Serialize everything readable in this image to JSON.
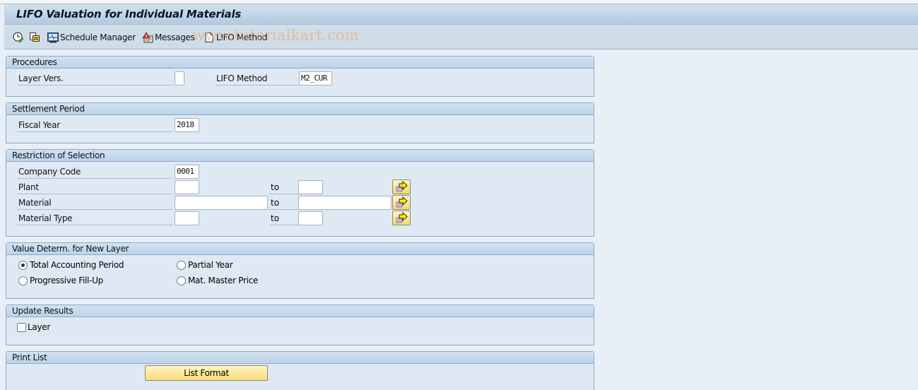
{
  "window": {
    "title": "LIFO Valuation for Individual Materials"
  },
  "toolbar": {
    "items": [
      {
        "icon": "execute-clock-icon",
        "label": ""
      },
      {
        "icon": "get-variant-icon",
        "label": ""
      },
      {
        "icon": "schedule-manager-icon",
        "label": "Schedule Manager"
      },
      {
        "icon": "messages-warning-icon",
        "label": "Messages"
      },
      {
        "icon": "document-icon",
        "label": "LIFO Method"
      }
    ]
  },
  "watermark": "www.tutorialkart.com",
  "groups": {
    "procedures": {
      "title": "Procedures",
      "layer_vers": {
        "label": "Layer Vers.",
        "value": ""
      },
      "lifo_method": {
        "label": "LIFO Method",
        "value": "M2_CUR"
      }
    },
    "settlement": {
      "title": "Settlement Period",
      "fiscal_year": {
        "label": "Fiscal Year",
        "value": "2018"
      }
    },
    "restriction": {
      "title": "Restriction of Selection",
      "company_code": {
        "label": "Company Code",
        "value": "0001"
      },
      "to_label": "to",
      "rows": [
        {
          "label": "Plant",
          "from": "",
          "to": ""
        },
        {
          "label": "Material",
          "from": "",
          "to": ""
        },
        {
          "label": "Material Type",
          "from": "",
          "to": ""
        }
      ]
    },
    "value_determ": {
      "title": "Value Determ. for New Layer",
      "options": [
        {
          "label": "Total Accounting Period",
          "selected": true
        },
        {
          "label": "Partial Year",
          "selected": false
        },
        {
          "label": "Progressive Fill-Up",
          "selected": false
        },
        {
          "label": "Mat. Master Price",
          "selected": false
        }
      ]
    },
    "update": {
      "title": "Update Results",
      "layer_checkbox": {
        "label": "Layer",
        "checked": false
      }
    },
    "print": {
      "title": "Print List",
      "list_format_button": "List Format"
    }
  },
  "colors": {
    "background": "#e8eff7",
    "group_body": "#dfe9f4",
    "button_yellow": "#f8dc78"
  }
}
